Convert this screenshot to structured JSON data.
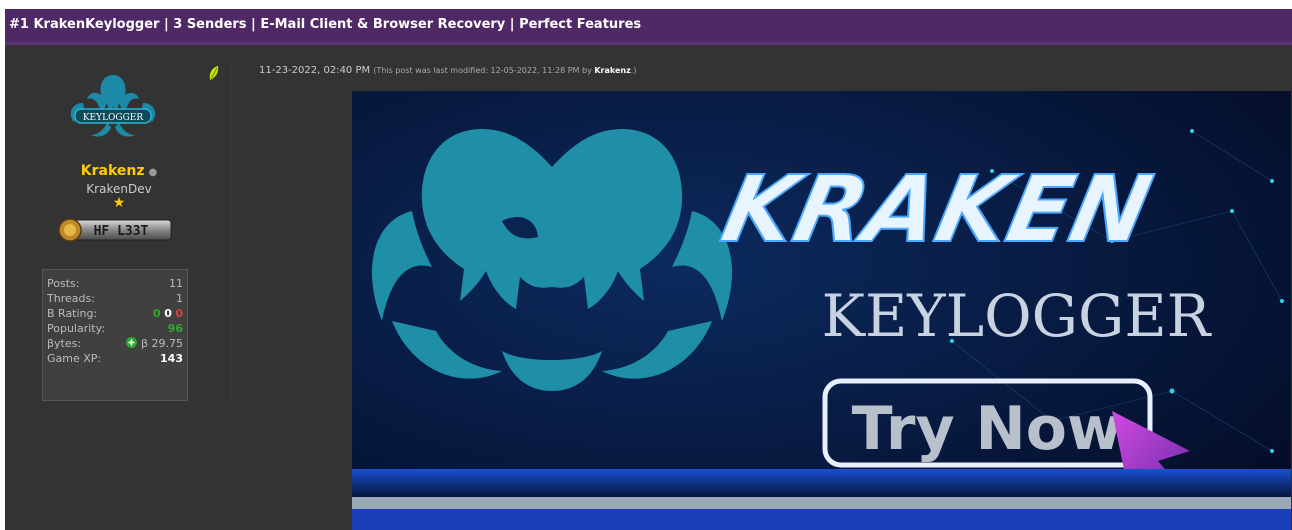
{
  "thread": {
    "title": "#1 KrakenKeylogger | 3 Senders | E-Mail Client & Browser Recovery | Perfect Features"
  },
  "user": {
    "avatar_text": "KEYLOGGER",
    "username": "Krakenz",
    "online_dot": "●",
    "usertitle": "KrakenDev",
    "star": "★",
    "badge_text": "HF L33T",
    "stats": [
      {
        "label": "Posts:",
        "value": "11"
      },
      {
        "label": "Threads:",
        "value": "1"
      },
      {
        "label": "B Rating:",
        "value_parts": [
          "0",
          "0",
          "0"
        ]
      },
      {
        "label": "Popularity:",
        "value": "96"
      },
      {
        "label": "βytes:",
        "value": "β 29.75"
      },
      {
        "label": "Game XP:",
        "value": "143"
      }
    ]
  },
  "post": {
    "date": "11-23-2022, 02:40 PM",
    "modified_prefix": "(This post was last modified: 12-05-2022, 11:28 PM by ",
    "modified_user": "Krakenz",
    "modified_suffix": ".)"
  },
  "banner": {
    "brand": "KRAKEN",
    "subtitle": "KEYLOGGER",
    "cta": "Try Now"
  },
  "colors": {
    "header_bg": "#4f2966",
    "page_bg": "#333333",
    "username": "#ffcc00",
    "banner_bg": "#06163d",
    "logo_teal": "#1f8fa8"
  }
}
